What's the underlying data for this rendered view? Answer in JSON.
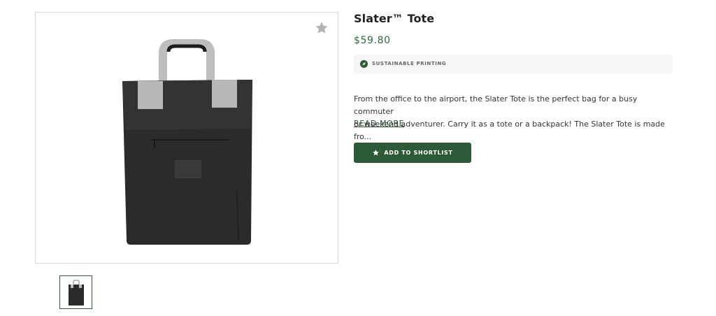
{
  "product": {
    "title": "Slater™ Tote",
    "price": "$59.80",
    "badge": "SUSTAINABLE PRINTING",
    "description_line1": "From the office to the airport, the Slater Tote is the perfect bag for a busy commuter",
    "description_line2": "or weekend adventurer. Carry it as a tote or a backpack! The Slater Tote is made fro...",
    "read_more": "READ MORE",
    "shortlist_label": "ADD TO SHORTLIST"
  },
  "icons": {
    "favorite": "star-icon",
    "badge": "leaf-icon",
    "shortlist": "star-icon"
  },
  "colors": {
    "accent": "#2d5a36",
    "price": "#2e6b3c",
    "badge_bg": "#f6f6f6"
  }
}
